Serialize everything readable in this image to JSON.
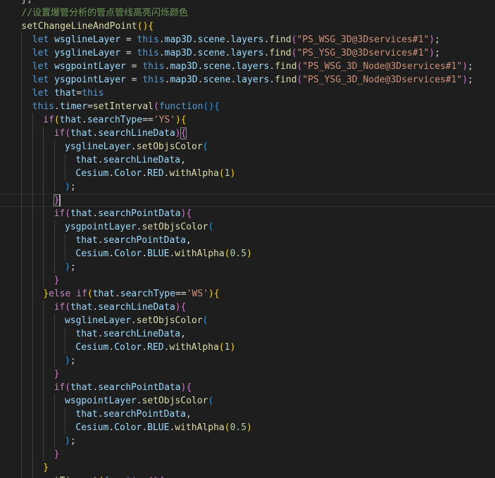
{
  "editor": {
    "colors": {
      "background": "#1e1e1e",
      "comment": "#6a9955",
      "keyword": "#569cd6",
      "control": "#c586c0",
      "variable": "#9cdcfe",
      "function": "#dcdcaa",
      "string": "#ce9178",
      "number": "#b5cea8"
    },
    "lines": [
      {
        "indent": 2,
        "tokens": [
          [
            "plain",
            "};"
          ]
        ]
      },
      {
        "indent": 2,
        "tokens": [
          [
            "comment",
            "//设置爆管分析的管点管线高亮闪烁颜色"
          ]
        ]
      },
      {
        "indent": 2,
        "tokens": [
          [
            "func",
            "setChangeLineAndPoint"
          ],
          [
            "bracket1",
            "("
          ],
          [
            "bracket1",
            ")"
          ],
          [
            "bracket1",
            "{"
          ]
        ]
      },
      {
        "indent": 4,
        "tokens": [
          [
            "keyword",
            "let "
          ],
          [
            "var",
            "wsglineLayer"
          ],
          [
            "plain",
            " = "
          ],
          [
            "keyword",
            "this"
          ],
          [
            "plain",
            "."
          ],
          [
            "var",
            "map3D"
          ],
          [
            "plain",
            "."
          ],
          [
            "var",
            "scene"
          ],
          [
            "plain",
            "."
          ],
          [
            "var",
            "layers"
          ],
          [
            "plain",
            "."
          ],
          [
            "func",
            "find"
          ],
          [
            "bracket2",
            "("
          ],
          [
            "string",
            "\"PS_WSG_3D@3Dservices#1\""
          ],
          [
            "bracket2",
            ")"
          ],
          [
            "plain",
            ";"
          ]
        ]
      },
      {
        "indent": 4,
        "tokens": [
          [
            "keyword",
            "let "
          ],
          [
            "var",
            "ysglineLayer"
          ],
          [
            "plain",
            " = "
          ],
          [
            "keyword",
            "this"
          ],
          [
            "plain",
            "."
          ],
          [
            "var",
            "map3D"
          ],
          [
            "plain",
            "."
          ],
          [
            "var",
            "scene"
          ],
          [
            "plain",
            "."
          ],
          [
            "var",
            "layers"
          ],
          [
            "plain",
            "."
          ],
          [
            "func",
            "find"
          ],
          [
            "bracket2",
            "("
          ],
          [
            "string",
            "\"PS_YSG_3D@3Dservices#1\""
          ],
          [
            "bracket2",
            ")"
          ],
          [
            "plain",
            ";"
          ]
        ]
      },
      {
        "indent": 4,
        "tokens": [
          [
            "keyword",
            "let "
          ],
          [
            "var",
            "wsgpointLayer"
          ],
          [
            "plain",
            " = "
          ],
          [
            "keyword",
            "this"
          ],
          [
            "plain",
            "."
          ],
          [
            "var",
            "map3D"
          ],
          [
            "plain",
            "."
          ],
          [
            "var",
            "scene"
          ],
          [
            "plain",
            "."
          ],
          [
            "var",
            "layers"
          ],
          [
            "plain",
            "."
          ],
          [
            "func",
            "find"
          ],
          [
            "bracket2",
            "("
          ],
          [
            "string",
            "\"PS_WSG_3D_Node@3Dservices#1\""
          ],
          [
            "bracket2",
            ")"
          ],
          [
            "plain",
            ";"
          ]
        ]
      },
      {
        "indent": 4,
        "tokens": [
          [
            "keyword",
            "let "
          ],
          [
            "var",
            "ysgpointLayer"
          ],
          [
            "plain",
            " = "
          ],
          [
            "keyword",
            "this"
          ],
          [
            "plain",
            "."
          ],
          [
            "var",
            "map3D"
          ],
          [
            "plain",
            "."
          ],
          [
            "var",
            "scene"
          ],
          [
            "plain",
            "."
          ],
          [
            "var",
            "layers"
          ],
          [
            "plain",
            "."
          ],
          [
            "func",
            "find"
          ],
          [
            "bracket2",
            "("
          ],
          [
            "string",
            "\"PS_YSG_3D_Node@3Dservices#1\""
          ],
          [
            "bracket2",
            ")"
          ],
          [
            "plain",
            ";"
          ]
        ]
      },
      {
        "indent": 4,
        "tokens": [
          [
            "keyword",
            "let "
          ],
          [
            "var",
            "that"
          ],
          [
            "plain",
            "="
          ],
          [
            "keyword",
            "this"
          ]
        ]
      },
      {
        "indent": 4,
        "tokens": [
          [
            "keyword",
            "this"
          ],
          [
            "plain",
            "."
          ],
          [
            "var",
            "timer"
          ],
          [
            "plain",
            "="
          ],
          [
            "func",
            "setInterval"
          ],
          [
            "bracket2",
            "("
          ],
          [
            "keyword",
            "function"
          ],
          [
            "bracket3",
            "("
          ],
          [
            "bracket3",
            ")"
          ],
          [
            "bracket3",
            "{"
          ]
        ]
      },
      {
        "indent": 6,
        "tokens": [
          [
            "control",
            "if"
          ],
          [
            "bracket1",
            "("
          ],
          [
            "var",
            "that"
          ],
          [
            "plain",
            "."
          ],
          [
            "var",
            "searchType"
          ],
          [
            "plain",
            "=="
          ],
          [
            "string",
            "'YS'"
          ],
          [
            "bracket1",
            ")"
          ],
          [
            "bracket1",
            "{"
          ]
        ]
      },
      {
        "indent": 8,
        "tokens": [
          [
            "control",
            "if"
          ],
          [
            "bracket2",
            "("
          ],
          [
            "var",
            "that"
          ],
          [
            "plain",
            "."
          ],
          [
            "var",
            "searchLineData"
          ],
          [
            "bracket2",
            ")"
          ],
          [
            "bracket2",
            "{",
            "match"
          ]
        ]
      },
      {
        "indent": 10,
        "tokens": [
          [
            "var",
            "ysglineLayer"
          ],
          [
            "plain",
            "."
          ],
          [
            "func",
            "setObjsColor"
          ],
          [
            "bracket3",
            "("
          ]
        ]
      },
      {
        "indent": 12,
        "tokens": [
          [
            "var",
            "that"
          ],
          [
            "plain",
            "."
          ],
          [
            "var",
            "searchLineData"
          ],
          [
            "plain",
            ","
          ]
        ]
      },
      {
        "indent": 12,
        "tokens": [
          [
            "var",
            "Cesium"
          ],
          [
            "plain",
            "."
          ],
          [
            "var",
            "Color"
          ],
          [
            "plain",
            "."
          ],
          [
            "var",
            "RED"
          ],
          [
            "plain",
            "."
          ],
          [
            "func",
            "withAlpha"
          ],
          [
            "bracket1",
            "("
          ],
          [
            "number",
            "1"
          ],
          [
            "bracket1",
            ")"
          ]
        ]
      },
      {
        "indent": 10,
        "tokens": [
          [
            "bracket3",
            ")"
          ],
          [
            "plain",
            ";"
          ]
        ]
      },
      {
        "indent": 8,
        "tokens": [
          [
            "bracket2",
            "}",
            "match"
          ]
        ],
        "current": true
      },
      {
        "indent": 8,
        "tokens": [
          [
            "control",
            "if"
          ],
          [
            "bracket2",
            "("
          ],
          [
            "var",
            "that"
          ],
          [
            "plain",
            "."
          ],
          [
            "var",
            "searchPointData"
          ],
          [
            "bracket2",
            ")"
          ],
          [
            "bracket2",
            "{"
          ]
        ]
      },
      {
        "indent": 10,
        "tokens": [
          [
            "var",
            "ysgpointLayer"
          ],
          [
            "plain",
            "."
          ],
          [
            "func",
            "setObjsColor"
          ],
          [
            "bracket3",
            "("
          ]
        ]
      },
      {
        "indent": 12,
        "tokens": [
          [
            "var",
            "that"
          ],
          [
            "plain",
            "."
          ],
          [
            "var",
            "searchPointData"
          ],
          [
            "plain",
            ","
          ]
        ]
      },
      {
        "indent": 12,
        "tokens": [
          [
            "var",
            "Cesium"
          ],
          [
            "plain",
            "."
          ],
          [
            "var",
            "Color"
          ],
          [
            "plain",
            "."
          ],
          [
            "var",
            "BLUE"
          ],
          [
            "plain",
            "."
          ],
          [
            "func",
            "withAlpha"
          ],
          [
            "bracket1",
            "("
          ],
          [
            "number",
            "0.5"
          ],
          [
            "bracket1",
            ")"
          ]
        ]
      },
      {
        "indent": 10,
        "tokens": [
          [
            "bracket3",
            ")"
          ],
          [
            "plain",
            ";"
          ]
        ]
      },
      {
        "indent": 8,
        "tokens": [
          [
            "bracket2",
            "}"
          ]
        ]
      },
      {
        "indent": 6,
        "tokens": [
          [
            "bracket1",
            "}"
          ],
          [
            "control",
            "else "
          ],
          [
            "control",
            "if"
          ],
          [
            "bracket1",
            "("
          ],
          [
            "var",
            "that"
          ],
          [
            "plain",
            "."
          ],
          [
            "var",
            "searchType"
          ],
          [
            "plain",
            "=="
          ],
          [
            "string",
            "'WS'"
          ],
          [
            "bracket1",
            ")"
          ],
          [
            "bracket1",
            "{"
          ]
        ]
      },
      {
        "indent": 8,
        "tokens": [
          [
            "control",
            "if"
          ],
          [
            "bracket2",
            "("
          ],
          [
            "var",
            "that"
          ],
          [
            "plain",
            "."
          ],
          [
            "var",
            "searchLineData"
          ],
          [
            "bracket2",
            ")"
          ],
          [
            "bracket2",
            "{"
          ]
        ]
      },
      {
        "indent": 10,
        "tokens": [
          [
            "var",
            "wsglineLayer"
          ],
          [
            "plain",
            "."
          ],
          [
            "func",
            "setObjsColor"
          ],
          [
            "bracket3",
            "("
          ]
        ]
      },
      {
        "indent": 12,
        "tokens": [
          [
            "var",
            "that"
          ],
          [
            "plain",
            "."
          ],
          [
            "var",
            "searchLineData"
          ],
          [
            "plain",
            ","
          ]
        ]
      },
      {
        "indent": 12,
        "tokens": [
          [
            "var",
            "Cesium"
          ],
          [
            "plain",
            "."
          ],
          [
            "var",
            "Color"
          ],
          [
            "plain",
            "."
          ],
          [
            "var",
            "RED"
          ],
          [
            "plain",
            "."
          ],
          [
            "func",
            "withAlpha"
          ],
          [
            "bracket1",
            "("
          ],
          [
            "number",
            "1"
          ],
          [
            "bracket1",
            ")"
          ]
        ]
      },
      {
        "indent": 10,
        "tokens": [
          [
            "bracket3",
            ")"
          ],
          [
            "plain",
            ";"
          ]
        ]
      },
      {
        "indent": 8,
        "tokens": [
          [
            "bracket2",
            "}"
          ]
        ]
      },
      {
        "indent": 8,
        "tokens": [
          [
            "control",
            "if"
          ],
          [
            "bracket2",
            "("
          ],
          [
            "var",
            "that"
          ],
          [
            "plain",
            "."
          ],
          [
            "var",
            "searchPointData"
          ],
          [
            "bracket2",
            ")"
          ],
          [
            "bracket2",
            "{"
          ]
        ]
      },
      {
        "indent": 10,
        "tokens": [
          [
            "var",
            "wsgpointLayer"
          ],
          [
            "plain",
            "."
          ],
          [
            "func",
            "setObjsColor"
          ],
          [
            "bracket3",
            "("
          ]
        ]
      },
      {
        "indent": 12,
        "tokens": [
          [
            "var",
            "that"
          ],
          [
            "plain",
            "."
          ],
          [
            "var",
            "searchPointData"
          ],
          [
            "plain",
            ","
          ]
        ]
      },
      {
        "indent": 12,
        "tokens": [
          [
            "var",
            "Cesium"
          ],
          [
            "plain",
            "."
          ],
          [
            "var",
            "Color"
          ],
          [
            "plain",
            "."
          ],
          [
            "var",
            "BLUE"
          ],
          [
            "plain",
            "."
          ],
          [
            "func",
            "withAlpha"
          ],
          [
            "bracket1",
            "("
          ],
          [
            "number",
            "0.5"
          ],
          [
            "bracket1",
            ")"
          ]
        ]
      },
      {
        "indent": 10,
        "tokens": [
          [
            "bracket3",
            ")"
          ],
          [
            "plain",
            ";"
          ]
        ]
      },
      {
        "indent": 8,
        "tokens": [
          [
            "bracket2",
            "}"
          ]
        ]
      },
      {
        "indent": 6,
        "tokens": [
          [
            "bracket1",
            "}"
          ]
        ]
      },
      {
        "indent": 6,
        "tokens": [
          [
            "func",
            "setTimeout"
          ],
          [
            "bracket1",
            "("
          ],
          [
            "keyword",
            "function"
          ],
          [
            "bracket2",
            "("
          ],
          [
            "bracket2",
            ")"
          ],
          [
            "bracket2",
            "{"
          ]
        ]
      }
    ]
  }
}
